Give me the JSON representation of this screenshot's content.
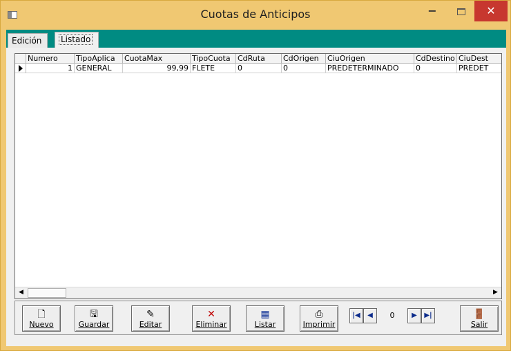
{
  "window": {
    "title": "Cuotas de Anticipos",
    "minimize_glyph": "−",
    "close_glyph": "✕"
  },
  "tabs": [
    {
      "label": "Edición",
      "selected": false
    },
    {
      "label": "Listado",
      "selected": true
    }
  ],
  "grid": {
    "columns": [
      "Numero",
      "TipoAplica",
      "CuotaMax",
      "TipoCuota",
      "CdRuta",
      "CdOrigen",
      "CiuOrigen",
      "CdDestino",
      "CiuDest"
    ],
    "rows": [
      {
        "Numero": "1",
        "TipoAplica": "GENERAL",
        "CuotaMax": "99,99",
        "TipoCuota": "FLETE",
        "CdRuta": "0",
        "CdOrigen": "0",
        "CiuOrigen": "PREDETERMINADO",
        "CdDestino": "0",
        "CiuDest": "PREDET"
      }
    ]
  },
  "toolbar": {
    "nuevo": "Nuevo",
    "guardar": "Guardar",
    "editar": "Editar",
    "eliminar": "Eliminar",
    "listar": "Listar",
    "imprimir": "Imprimir",
    "salir": "Salir"
  },
  "navigator": {
    "value": "0"
  },
  "icons": {
    "nuevo": "new-document-icon",
    "guardar": "save-icon",
    "editar": "edit-icon",
    "eliminar": "delete-icon",
    "listar": "list-icon",
    "imprimir": "printer-icon",
    "salir": "exit-door-icon"
  },
  "colors": {
    "titlebar": "#f0c872",
    "tabstrip": "#008b82",
    "close_button": "#c7372f",
    "delete_icon": "#c00000"
  }
}
